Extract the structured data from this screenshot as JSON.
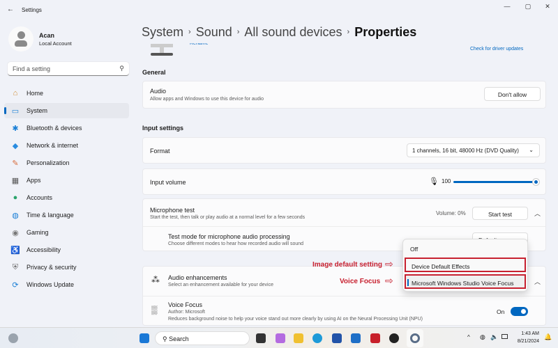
{
  "window": {
    "title": "Settings",
    "minimize": "—",
    "maximize": "▢",
    "close": "✕"
  },
  "user": {
    "name": "Acan",
    "account": "Local Account"
  },
  "search": {
    "placeholder": "Find a setting"
  },
  "nav": [
    {
      "label": "Home",
      "icon": "home-icon",
      "glyph": "⌂",
      "color": "#d08a30"
    },
    {
      "label": "System",
      "icon": "system-icon",
      "glyph": "▭",
      "color": "#1a7fd6"
    },
    {
      "label": "Bluetooth & devices",
      "icon": "bluetooth-icon",
      "glyph": "✱",
      "color": "#1a7fd6"
    },
    {
      "label": "Network & internet",
      "icon": "network-icon",
      "glyph": "◆",
      "color": "#2a8ce0"
    },
    {
      "label": "Personalization",
      "icon": "brush-icon",
      "glyph": "✎",
      "color": "#d86b3a"
    },
    {
      "label": "Apps",
      "icon": "apps-icon",
      "glyph": "▦",
      "color": "#555"
    },
    {
      "label": "Accounts",
      "icon": "accounts-icon",
      "glyph": "●",
      "color": "#2aa36b"
    },
    {
      "label": "Time & language",
      "icon": "globe-icon",
      "glyph": "◍",
      "color": "#1a7fd6"
    },
    {
      "label": "Gaming",
      "icon": "gaming-icon",
      "glyph": "◉",
      "color": "#777"
    },
    {
      "label": "Accessibility",
      "icon": "accessibility-icon",
      "glyph": "♿",
      "color": "#1a6fc0"
    },
    {
      "label": "Privacy & security",
      "icon": "shield-icon",
      "glyph": "⛨",
      "color": "#666"
    },
    {
      "label": "Windows Update",
      "icon": "update-icon",
      "glyph": "⟳",
      "color": "#1a7fd6"
    }
  ],
  "breadcrumb": [
    "System",
    "Sound",
    "All sound devices",
    "Properties"
  ],
  "device": {
    "rename": "Rename",
    "driver_link": "Check for driver updates"
  },
  "general": {
    "heading": "General",
    "audio_title": "Audio",
    "audio_desc": "Allow apps and Windows to use this device for audio",
    "audio_button": "Don't allow"
  },
  "input": {
    "heading": "Input settings",
    "format_label": "Format",
    "format_value": "1 channels, 16 bit, 48000 Hz (DVD Quality)",
    "volume_label": "Input volume",
    "volume_value": "100",
    "volume_percent": 100
  },
  "mic_test": {
    "title": "Microphone test",
    "desc": "Start the test, then talk or play audio at a normal level for a few seconds",
    "volume": "Volume: 0%",
    "button": "Start test",
    "mode_title": "Test mode for microphone audio processing",
    "mode_desc": "Choose different modes to hear how recorded audio will sound",
    "mode_value": "Default"
  },
  "dropdown": {
    "options": [
      "Off",
      "Device Default Effects",
      "Microsoft Windows Studio Voice Focus"
    ]
  },
  "annotations": {
    "default": "Image default setting",
    "voice": "Voice Focus"
  },
  "enhancements": {
    "title": "Audio enhancements",
    "desc": "Select an enhancement available for your device"
  },
  "voice_focus": {
    "title": "Voice Focus",
    "author": "Author: Microsoft",
    "desc": "Reduces background noise to help your voice stand out more clearly by using AI on the Neural Processing Unit (NPU)",
    "state": "On"
  },
  "taskbar": {
    "search": "Search",
    "time": "1:43 AM",
    "date": "8/21/2024"
  }
}
